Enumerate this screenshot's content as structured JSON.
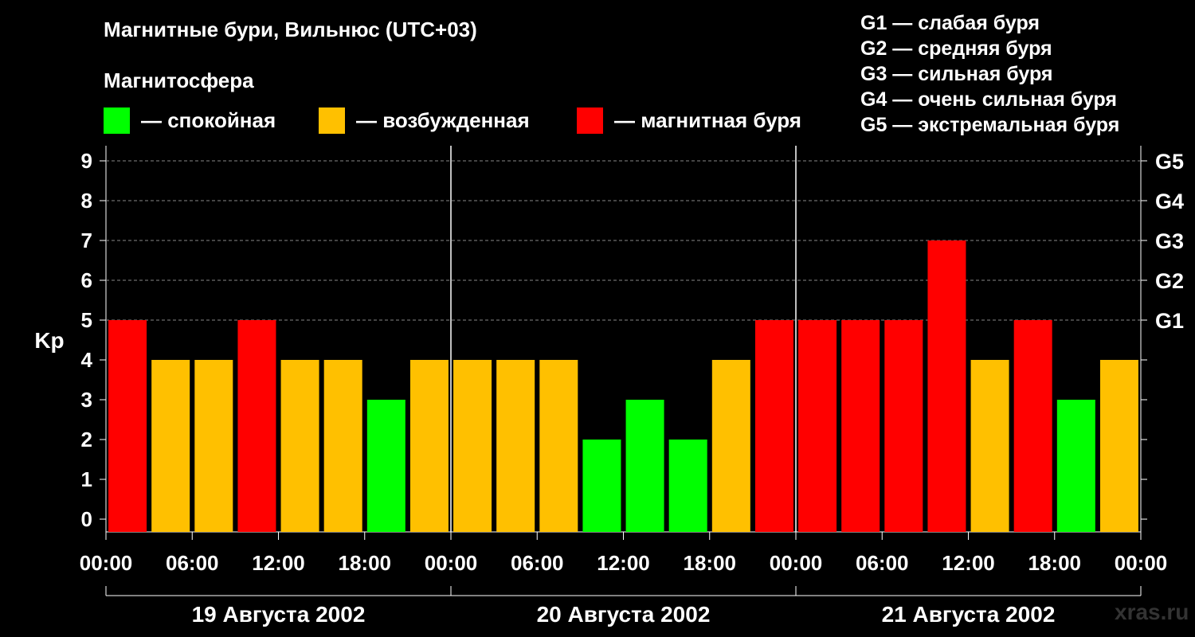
{
  "header": {
    "title": "Магнитные бури, Вильнюс (UTC+03)",
    "subtitle": "Магнитосфера"
  },
  "legend": [
    {
      "label": "— спокойная",
      "color": "#00ff00"
    },
    {
      "label": "— возбужденная",
      "color": "#ffc000"
    },
    {
      "label": "— магнитная буря",
      "color": "#ff0000"
    }
  ],
  "storm_scale": [
    "G1 — слабая буря",
    "G2 — средняя буря",
    "G3 — сильная буря",
    "G4 — очень сильная буря",
    "G5 — экстремальная буря"
  ],
  "watermark": "xras.ru",
  "chart_data": {
    "type": "bar",
    "ylabel": "Kp",
    "ylim": [
      0,
      9
    ],
    "yticks": [
      0,
      1,
      2,
      3,
      4,
      5,
      6,
      7,
      8,
      9
    ],
    "right_axis_labels": [
      {
        "value": 5,
        "label": "G1"
      },
      {
        "value": 6,
        "label": "G2"
      },
      {
        "value": 7,
        "label": "G3"
      },
      {
        "value": 8,
        "label": "G4"
      },
      {
        "value": 9,
        "label": "G5"
      }
    ],
    "grid": true,
    "time_tick_labels": [
      "00:00",
      "06:00",
      "12:00",
      "18:00",
      "00:00",
      "06:00",
      "12:00",
      "18:00",
      "00:00",
      "06:00",
      "12:00",
      "18:00",
      "00:00"
    ],
    "days": [
      "19 Августа 2002",
      "20 Августа 2002",
      "21 Августа 2002"
    ],
    "interval_hours": 3,
    "values": [
      5,
      4,
      4,
      5,
      4,
      4,
      3,
      4,
      4,
      4,
      4,
      2,
      3,
      2,
      4,
      5,
      5,
      5,
      5,
      7,
      4,
      5,
      3,
      4
    ],
    "color_rules": {
      "calm_max": 3,
      "disturbed_max": 4
    },
    "colors": {
      "calm": "#00ff00",
      "disturbed": "#ffc000",
      "storm": "#ff0000"
    }
  }
}
